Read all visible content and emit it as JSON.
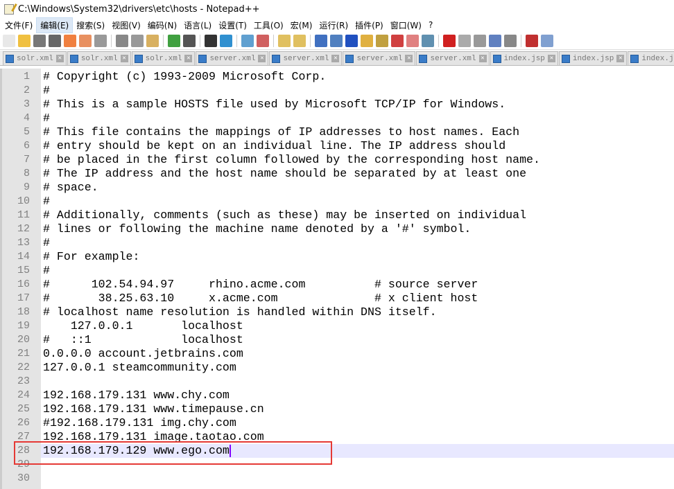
{
  "window": {
    "title": "C:\\Windows\\System32\\drivers\\etc\\hosts - Notepad++"
  },
  "menu": [
    "文件(F)",
    "编辑(E)",
    "搜索(S)",
    "视图(V)",
    "编码(N)",
    "语言(L)",
    "设置(T)",
    "工具(O)",
    "宏(M)",
    "运行(R)",
    "插件(P)",
    "窗口(W)",
    "?"
  ],
  "toolbar": [
    {
      "icon": "new-file",
      "color": "#e8e8e8"
    },
    {
      "icon": "open-file",
      "color": "#f0c040"
    },
    {
      "icon": "save",
      "color": "#777"
    },
    {
      "icon": "save-all",
      "color": "#666"
    },
    {
      "icon": "close",
      "color": "#f08040"
    },
    {
      "icon": "close-all",
      "color": "#e89060"
    },
    {
      "icon": "print",
      "color": "#999"
    },
    "sep",
    {
      "icon": "cut",
      "color": "#888"
    },
    {
      "icon": "copy",
      "color": "#999"
    },
    {
      "icon": "paste",
      "color": "#d8b060"
    },
    "sep",
    {
      "icon": "undo",
      "color": "#40a040"
    },
    {
      "icon": "redo",
      "color": "#555"
    },
    "sep",
    {
      "icon": "find",
      "color": "#333"
    },
    {
      "icon": "replace",
      "color": "#3090d0"
    },
    "sep",
    {
      "icon": "zoom-in",
      "color": "#60a0d0"
    },
    {
      "icon": "zoom-out",
      "color": "#d06060"
    },
    "sep",
    {
      "icon": "sync-vertical",
      "color": "#e0c060"
    },
    {
      "icon": "sync-horizontal",
      "color": "#e0c060"
    },
    "sep",
    {
      "icon": "word-wrap",
      "color": "#4070c0"
    },
    {
      "icon": "show-all-chars",
      "color": "#5080c0"
    },
    {
      "icon": "indent-guide",
      "color": "#2050c0"
    },
    {
      "icon": "language",
      "color": "#e0b040"
    },
    {
      "icon": "doc-map",
      "color": "#c0a040"
    },
    {
      "icon": "function-list",
      "color": "#d04040"
    },
    {
      "icon": "folder-workspace",
      "color": "#e08080"
    },
    {
      "icon": "monitoring",
      "color": "#6090b0"
    },
    "sep",
    {
      "icon": "record-macro",
      "color": "#d02020"
    },
    {
      "icon": "stop-record",
      "color": "#aaa"
    },
    {
      "icon": "play-macro",
      "color": "#999"
    },
    {
      "icon": "run-macro-multiple",
      "color": "#6080c0"
    },
    {
      "icon": "save-macro",
      "color": "#888"
    },
    "sep",
    {
      "icon": "spell-check",
      "color": "#c03030"
    },
    {
      "icon": "highlight",
      "color": "#80a0d0"
    }
  ],
  "tabs": [
    "solr.xml",
    "solr.xml",
    "solr.xml",
    "server.xml",
    "server.xml",
    "server.xml",
    "server.xml",
    "index.jsp",
    "index.jsp",
    "index.jsp"
  ],
  "editor": {
    "current_line": 28,
    "lines": [
      "# Copyright (c) 1993-2009 Microsoft Corp.",
      "#",
      "# This is a sample HOSTS file used by Microsoft TCP/IP for Windows.",
      "#",
      "# This file contains the mappings of IP addresses to host names. Each",
      "# entry should be kept on an individual line. The IP address should",
      "# be placed in the first column followed by the corresponding host name.",
      "# The IP address and the host name should be separated by at least one",
      "# space.",
      "#",
      "# Additionally, comments (such as these) may be inserted on individual",
      "# lines or following the machine name denoted by a '#' symbol.",
      "#",
      "# For example:",
      "#",
      "#      102.54.94.97     rhino.acme.com          # source server",
      "#       38.25.63.10     x.acme.com              # x client host",
      "# localhost name resolution is handled within DNS itself.",
      "    127.0.0.1       localhost",
      "#   ::1             localhost",
      "0.0.0.0 account.jetbrains.com",
      "127.0.0.1 steamcommunity.com",
      "",
      "192.168.179.131 www.chy.com",
      "192.168.179.131 www.timepause.cn",
      "#192.168.179.131 img.chy.com",
      "192.168.179.131 image.taotao.com",
      "192.168.179.129 www.ego.com",
      "",
      ""
    ]
  },
  "colors": {
    "highlight_box": "#e53935",
    "current_line": "#e8e8ff",
    "caret": "#8000ff"
  }
}
